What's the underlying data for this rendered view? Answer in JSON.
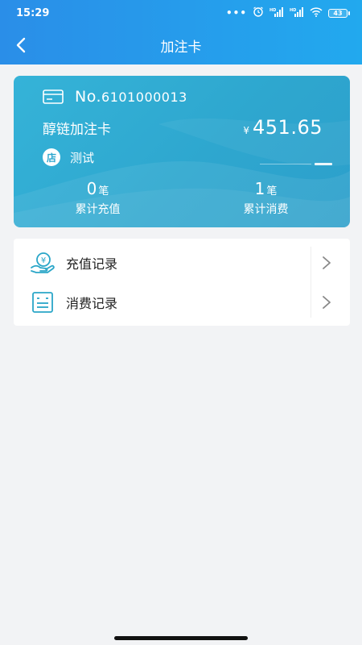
{
  "status_bar": {
    "time": "15:29",
    "battery": "43"
  },
  "nav": {
    "title": "加注卡"
  },
  "card": {
    "no_prefix": "No.",
    "no_value": "6101000013",
    "name": "醇链加注卡",
    "currency": "¥",
    "balance": "451.65",
    "store_badge": "店",
    "store_name": "测试",
    "recharge_count": "0",
    "recharge_unit": "笔",
    "recharge_label": "累计充值",
    "consume_count": "1",
    "consume_unit": "笔",
    "consume_label": "累计消费"
  },
  "menu": {
    "items": [
      {
        "label": "充值记录",
        "icon": "recharge-icon"
      },
      {
        "label": "消费记录",
        "icon": "receipt-icon"
      }
    ]
  },
  "colors": {
    "header": "#2a8ee8",
    "card": "#2ea7cf",
    "icon": "#2aa6c8",
    "background": "#f2f3f5"
  }
}
